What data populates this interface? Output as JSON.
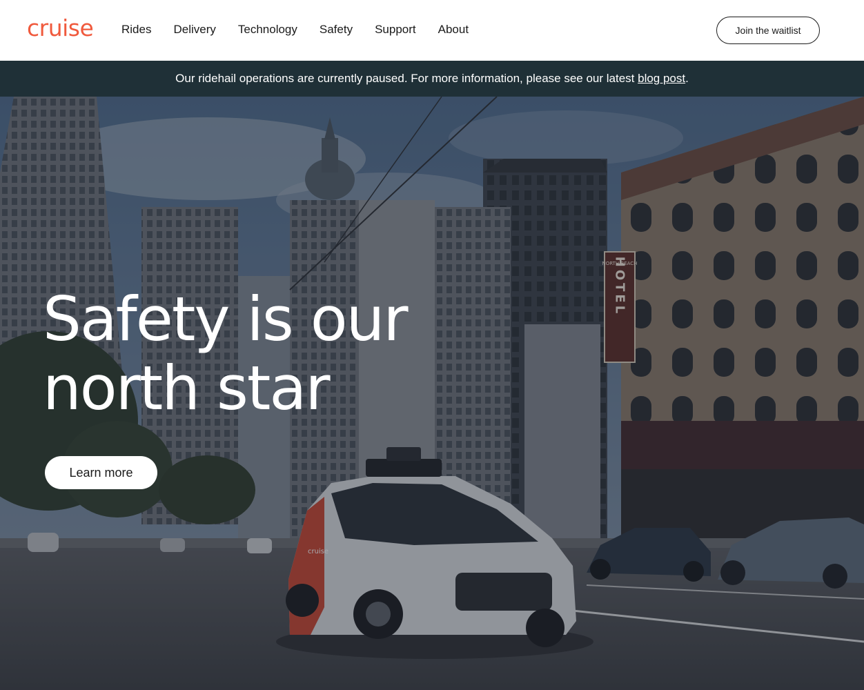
{
  "brand": {
    "logo_text": "cruise",
    "color": "#f05a3d"
  },
  "nav": {
    "items": [
      {
        "label": "Rides"
      },
      {
        "label": "Delivery"
      },
      {
        "label": "Technology"
      },
      {
        "label": "Safety"
      },
      {
        "label": "Support"
      },
      {
        "label": "About"
      }
    ],
    "cta_label": "Join the waitlist"
  },
  "banner": {
    "text": "Our ridehail operations are currently paused. For more information, please see our latest ",
    "link_label": "blog post",
    "suffix": ".",
    "background": "#1f3037"
  },
  "hero": {
    "title_line1": "Safety is our",
    "title_line2": "north star",
    "button_label": "Learn more",
    "image": "city street with a white autonomous car (cruise) in front of tall buildings and the North Beach Hotel",
    "sign_text": "HOTEL",
    "sign_top": "NORTH BEACH",
    "car_brand": "cruise"
  }
}
